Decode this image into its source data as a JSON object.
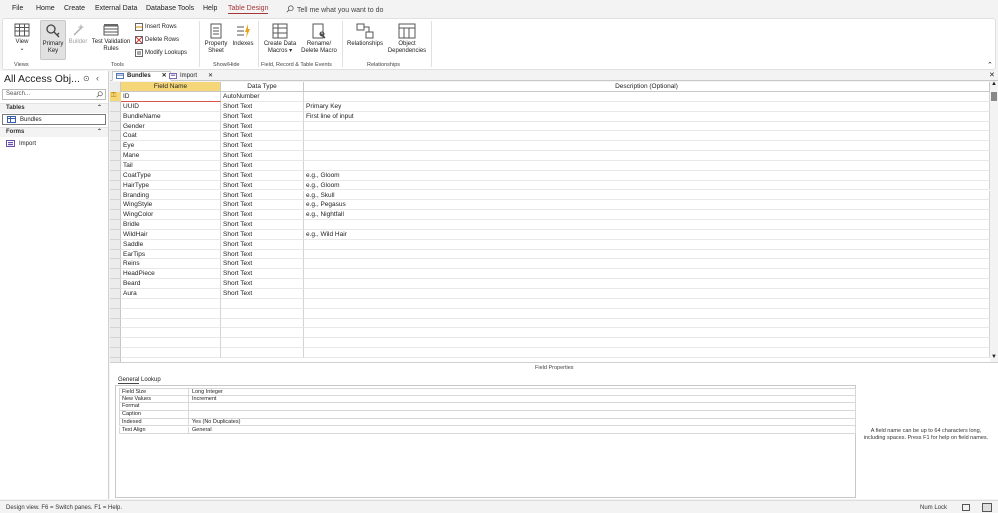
{
  "menu": {
    "tabs": [
      "File",
      "Home",
      "Create",
      "External Data",
      "Database Tools",
      "Help",
      "Table Design"
    ],
    "active_tab": "Table Design",
    "tell_me": "Tell me what you want to do"
  },
  "ribbon": {
    "view": "View",
    "primary_key": [
      "Primary",
      "Key"
    ],
    "builder": "Builder",
    "test_validation": [
      "Test Validation",
      "Rules"
    ],
    "insert_rows": "Insert Rows",
    "delete_rows": "Delete Rows",
    "modify_lookups": "Modify Lookups",
    "property_sheet": [
      "Property",
      "Sheet"
    ],
    "indexes": "Indexes",
    "create_data_macros": [
      "Create Data",
      "Macros ▾"
    ],
    "rename_delete_macro": [
      "Rename/",
      "Delete Macro"
    ],
    "relationships": "Relationships",
    "object_dependencies": [
      "Object",
      "Dependencies"
    ],
    "groups": {
      "views": "Views",
      "tools": "Tools",
      "show_hide": "Show/Hide",
      "field_record_events": "Field, Record & Table Events",
      "relationships": "Relationships"
    }
  },
  "nav": {
    "title": "All Access Obj...",
    "search_placeholder": "Search...",
    "tables_header": "Tables",
    "tables": [
      "Bundles"
    ],
    "forms_header": "Forms",
    "forms": [
      "Import"
    ]
  },
  "doc_tabs": [
    {
      "label": "Bundles",
      "active": true
    },
    {
      "label": "Import",
      "active": false
    }
  ],
  "grid": {
    "headers": [
      "Field Name",
      "Data Type",
      "Description (Optional)"
    ],
    "rows": [
      {
        "name": "ID",
        "type": "AutoNumber",
        "desc": "",
        "key": true
      },
      {
        "name": "UUID",
        "type": "Short Text",
        "desc": "Primary Key"
      },
      {
        "name": "BundleName",
        "type": "Short Text",
        "desc": "First line of input"
      },
      {
        "name": "Gender",
        "type": "Short Text",
        "desc": ""
      },
      {
        "name": "Coat",
        "type": "Short Text",
        "desc": ""
      },
      {
        "name": "Eye",
        "type": "Short Text",
        "desc": ""
      },
      {
        "name": "Mane",
        "type": "Short Text",
        "desc": ""
      },
      {
        "name": "Tail",
        "type": "Short Text",
        "desc": ""
      },
      {
        "name": "CoatType",
        "type": "Short Text",
        "desc": "e.g., Gloom"
      },
      {
        "name": "HairType",
        "type": "Short Text",
        "desc": "e.g., Gloom"
      },
      {
        "name": "Branding",
        "type": "Short Text",
        "desc": "e.g., Skull"
      },
      {
        "name": "WingStyle",
        "type": "Short Text",
        "desc": "e.g., Pegasus"
      },
      {
        "name": "WingColor",
        "type": "Short Text",
        "desc": "e.g., Nightfall"
      },
      {
        "name": "Bridle",
        "type": "Short Text",
        "desc": ""
      },
      {
        "name": "WildHair",
        "type": "Short Text",
        "desc": "e.g., Wild Hair"
      },
      {
        "name": "Saddle",
        "type": "Short Text",
        "desc": ""
      },
      {
        "name": "EarTips",
        "type": "Short Text",
        "desc": ""
      },
      {
        "name": "Reins",
        "type": "Short Text",
        "desc": ""
      },
      {
        "name": "HeadPiece",
        "type": "Short Text",
        "desc": ""
      },
      {
        "name": "Beard",
        "type": "Short Text",
        "desc": ""
      },
      {
        "name": "Aura",
        "type": "Short Text",
        "desc": ""
      }
    ]
  },
  "field_properties": {
    "title": "Field Properties",
    "tabs": [
      "General",
      "Lookup"
    ],
    "props": [
      {
        "name": "Field Size",
        "value": "Long Integer"
      },
      {
        "name": "New Values",
        "value": "Increment"
      },
      {
        "name": "Format",
        "value": ""
      },
      {
        "name": "Caption",
        "value": ""
      },
      {
        "name": "Indexed",
        "value": "Yes (No Duplicates)"
      },
      {
        "name": "Text Align",
        "value": "General"
      }
    ],
    "help": "A field name can be up to 64 characters long, including spaces. Press F1 for help on field names."
  },
  "status": {
    "left": "Design view.  F6 = Switch panes.  F1 = Help.",
    "num_lock": "Num Lock"
  },
  "colors": {
    "accent": "#a4373a",
    "header_highlight": "#f5d77a"
  }
}
